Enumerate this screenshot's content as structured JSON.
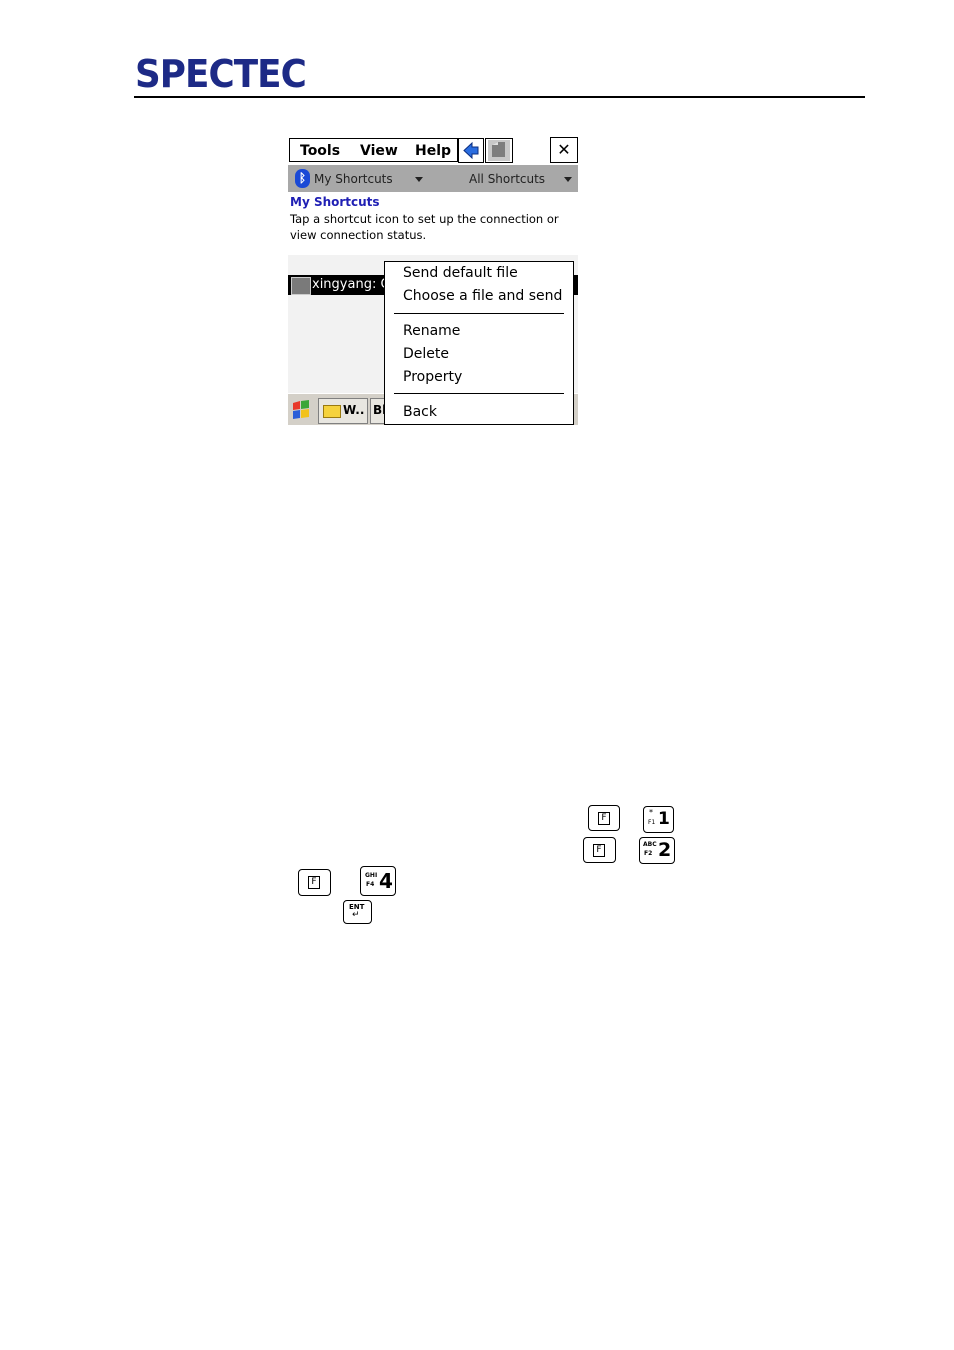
{
  "header": {
    "logo_text": "SPECTEC"
  },
  "screen": {
    "menubar": {
      "tools": "Tools",
      "view": "View",
      "help": "Help",
      "close": "✕"
    },
    "filterbar": {
      "left_filter": "My Shortcuts",
      "right_filter": "All Shortcuts"
    },
    "section_title": "My Shortcuts",
    "section_desc": "Tap a shortcut icon to set up the connection or view connection status.",
    "shortcut_label": "xingyang: C",
    "taskbar": {
      "folder_label": "W..",
      "bt_label": "Bl"
    },
    "context_menu": {
      "send_default": "Send default file",
      "choose_send": "Choose a file and send",
      "rename": "Rename",
      "delete": "Delete",
      "property": "Property",
      "back": "Back"
    }
  },
  "keys": {
    "f_label": "F",
    "key1": {
      "top": "*",
      "sub": "F1",
      "digit": "1"
    },
    "key2": {
      "top": "ABC",
      "sub": "F2",
      "digit": "2"
    },
    "key4": {
      "top": "GHI",
      "sub": "F4",
      "digit": "4"
    },
    "enter": {
      "top": "ENT",
      "sub": "↵"
    }
  }
}
